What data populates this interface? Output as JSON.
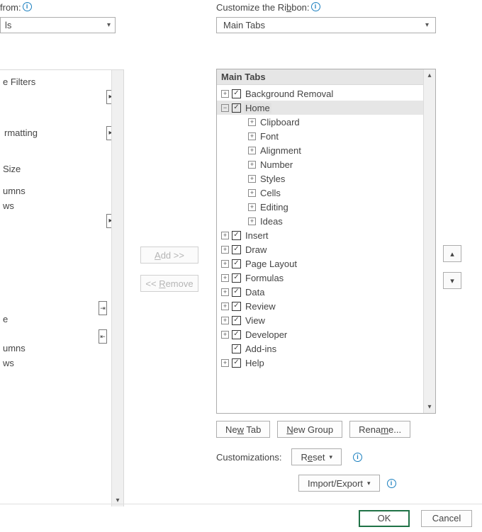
{
  "left": {
    "from_label_tail": "from:",
    "select_tail": "ls",
    "items": {
      "filters": "e Filters",
      "matting": "rmatting",
      "size": "Size",
      "umns1": "umns",
      "ws1": "ws",
      "e": "e",
      "umns2": "umns",
      "ws2": "ws"
    }
  },
  "mid": {
    "add": "Add >>",
    "remove": "<< Remove"
  },
  "right": {
    "label": "Customize the Ribbon:",
    "select_value": "Main Tabs",
    "tree_header": "Main Tabs",
    "tabs": {
      "bg": "Background Removal",
      "home": "Home",
      "home_children": {
        "clipboard": "Clipboard",
        "font": "Font",
        "alignment": "Alignment",
        "number": "Number",
        "styles": "Styles",
        "cells": "Cells",
        "editing": "Editing",
        "ideas": "Ideas"
      },
      "insert": "Insert",
      "draw": "Draw",
      "pagelayout": "Page Layout",
      "formulas": "Formulas",
      "data": "Data",
      "review": "Review",
      "view": "View",
      "developer": "Developer",
      "addins": "Add-ins",
      "help": "Help"
    },
    "buttons": {
      "new_tab": "New Tab",
      "new_group": "New Group",
      "rename": "Rename...",
      "cust_label": "Customizations:",
      "reset": "Reset",
      "import": "Import/Export"
    }
  },
  "footer": {
    "ok": "OK",
    "cancel": "Cancel"
  },
  "glyph": {
    "plus": "+",
    "minus": "−",
    "check": "✓",
    "caret_down": "▾",
    "tri_right": "▸",
    "tri_up": "▴",
    "tri_down": "▾"
  }
}
